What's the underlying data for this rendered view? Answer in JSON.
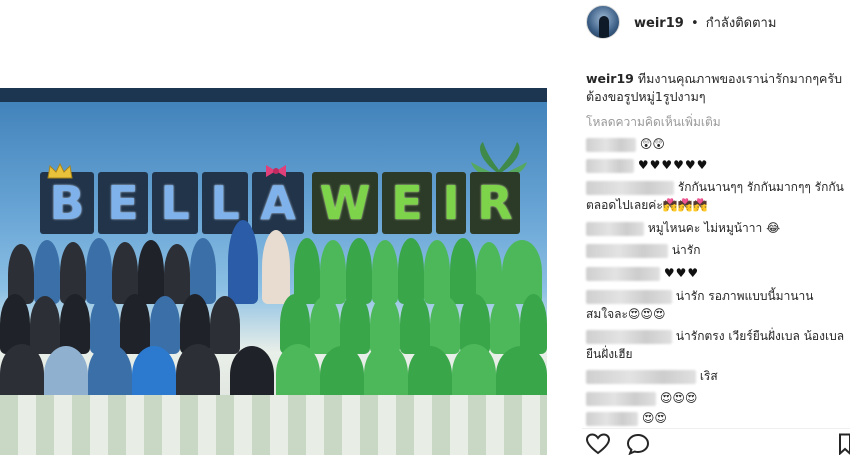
{
  "post": {
    "username": "weir19",
    "separator": "•",
    "follow_status": "กำลังติดตาม",
    "caption": "ทีมงานคุณภาพของเราน่ารักมากๆครับ ต้องขอรูปหมู่1รูปงามๆ",
    "load_more": "โหลดความคิดเห็นเพิ่มเติม"
  },
  "photo": {
    "sign_letters": [
      "B",
      "E",
      "L",
      "L",
      "A",
      "W",
      "E",
      "I",
      "R"
    ]
  },
  "comments": [
    {
      "text": "😲😲"
    },
    {
      "text": "♥♥♥♥♥♥"
    },
    {
      "text": "รักกันนานๆๆ รักกันมากๆๆ รักกัน"
    },
    {
      "text": "ตลอดไปเลยค่ะ💏💏💏"
    },
    {
      "text": "หมูไหนคะ  ไม่หมูน้าาา 😂"
    },
    {
      "text": "น่ารัก"
    },
    {
      "text": "♥♥♥"
    },
    {
      "text": "น่ารัก รอภาพแบบนี้มานาน"
    },
    {
      "text": "สมใจละ😍😍😍"
    },
    {
      "text": "น่ารักตรง เวียร์ยืนฝั่งเบล น้องเบล"
    },
    {
      "text": "ยืนฝั่งเฮีย"
    },
    {
      "text": "เริส"
    },
    {
      "text": "😍😍😍"
    },
    {
      "text": "😍😍"
    }
  ],
  "icons": {
    "like": "heart-icon",
    "comment": "comment-icon",
    "save": "bookmark-icon"
  },
  "colors": {
    "text": "#262626",
    "muted": "#999999",
    "sign_blue": "#7fb2ea",
    "sign_green": "#7dd34a"
  }
}
